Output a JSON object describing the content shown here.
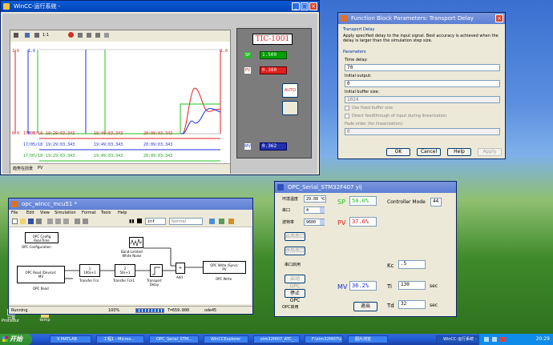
{
  "desktop": {
    "icons": [
      {
        "label": "计算"
      },
      {
        "label": "Procedur"
      },
      {
        "label": "temp"
      }
    ]
  },
  "wincc": {
    "title": "WinCC-运行系统 -",
    "toolbar": {
      "page_counter": "1:1"
    },
    "trend": {
      "left_axis": {
        "top": "1.0",
        "bottom": "0.0"
      },
      "mid_axis": {
        "top": "1.0",
        "bottom": "0.0"
      },
      "right_axis_top": "1.0",
      "time_rows": [
        {
          "date": "17/05/18",
          "t1": "19:29:03.343",
          "t2": "19:49:03.343",
          "t3": "20:09:03.343"
        },
        {
          "date": "17/05/18",
          "t1": "19:29:03.343",
          "t2": "19:49:03.343",
          "t3": "20:09:03.343"
        },
        {
          "date": "17/05/18",
          "t1": "19:29:03.343",
          "t2": "19:49:03.343",
          "t3": "20:09:03.343"
        }
      ],
      "status_left": "趋势在前景",
      "status_right": "PV"
    },
    "panel": {
      "tag": "TIC-1001",
      "sp_label": "SP",
      "sp_value": "1.500",
      "pv_label": "PV",
      "pv_value": "0.380",
      "mode_button": "AUTO",
      "mv_label": "MV",
      "mv_value": "0.362"
    }
  },
  "fbp": {
    "title": "Function Block Parameters: Transport Delay",
    "section": "Transport Delay",
    "description": "Apply specified delay to the input signal. Best accuracy is achieved when the delay is larger than the simulation step size.",
    "parameters_label": "Parameters",
    "time_delay_label": "Time delay:",
    "time_delay_value": "70",
    "initial_output_label": "Initial output:",
    "initial_output_value": "0",
    "initial_buffer_label": "Initial buffer size:",
    "initial_buffer_value": "1024",
    "chk_fixed": "Use fixed buffer size",
    "chk_direct": "Direct feedthrough of input during linearization",
    "pade_label": "Pade order (for linearization):",
    "pade_value": "0",
    "buttons": {
      "ok": "OK",
      "cancel": "Cancel",
      "help": "Help",
      "apply": "Apply"
    }
  },
  "opc": {
    "title": "OPC_Serial_STM32F407 yij",
    "temp_label": "环境温度",
    "temp_value": "29.08 ℃",
    "port_label": "串口",
    "port_value": "4",
    "baud_label": "波特率",
    "baud_value": "9600",
    "btn_open": "启用串口",
    "btn_stop_port": "停用串口",
    "serial_status": "串口启用",
    "btn_start_opc": "启动OPC",
    "btn_stop_opc": "停止OPC",
    "opc_status": "OPC启用",
    "sp_label": "SP",
    "sp_value": "50.0%",
    "pv_label": "PV",
    "pv_value": "37.6%",
    "mv_label": "MV",
    "mv_value": "36.2%",
    "mode_label": "Controller Mode",
    "mode_value": "44",
    "kc_label": "Kc",
    "kc_value": ".5",
    "ti_label": "Ti",
    "ti_value": "130",
    "ti_unit": "sec",
    "td_label": "Td",
    "td_value": "32",
    "td_unit": "sec",
    "exit_button": "退出"
  },
  "simulink": {
    "title": "opc_wincc_mcu51 *",
    "menu": [
      "File",
      "Edit",
      "View",
      "Simulation",
      "Format",
      "Tools",
      "Help"
    ],
    "stop_time": "inf",
    "sim_mode": "Normal",
    "blocks": {
      "opc_config": "OPC Config\nReal-Time",
      "opc_config_label": "OPC Configuration",
      "opc_read": "OPC Read (Device):\nMV",
      "opc_read_label": "OPC Read",
      "tf1": "1\n100s+1",
      "tf1_label": "Transfer Fcn",
      "tf2": "2\n50s+1",
      "tf2_label": "Transfer Fcn1",
      "noise_label": "Band-Limited\nWhite Noise",
      "delay_label": "Transport\nDelay",
      "add_label": "Add",
      "opc_write": "OPC Write (Sync):\nPV",
      "opc_write_label": "OPC Write"
    },
    "status": {
      "state": "Running",
      "zoom": "100%",
      "time": "T=659.800",
      "solver": "ode45"
    }
  },
  "taskbar": {
    "start": "开始",
    "tasks": [
      "9 MATLAB",
      "工程1 - Micros...",
      "OPC_Serial_STM...",
      "WinCCExplorer",
      "stm32f407_ATC_...",
      "F:\\stm32f407\\c...",
      "图片浏览",
      "WinCC-运行系统 -"
    ],
    "clock": "20:29"
  }
}
